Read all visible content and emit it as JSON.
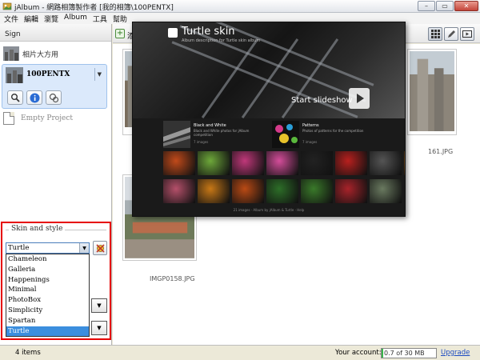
{
  "window": {
    "title": "jAlbum - 網路相簿製作者 [我的相簿\\100PENTX]",
    "controls": {
      "minimize": "–",
      "maximize": "▭",
      "close": "✕"
    }
  },
  "menu": [
    "文件",
    "編輯",
    "瀏覽",
    "Album",
    "工具",
    "幫助"
  ],
  "left_panel": {
    "header": "Sign",
    "projects": [
      {
        "label": "相片大方用",
        "active": false
      },
      {
        "label": "100PENTX",
        "active": true
      },
      {
        "label": "Empty Project",
        "active": false
      }
    ],
    "tool_icons": [
      "magnifier-icon",
      "info-icon",
      "explore-icon"
    ]
  },
  "skin": {
    "legend": "Skin and style",
    "selected": "Turtle",
    "options": [
      "Chameleon",
      "Galleria",
      "Happenings",
      "Minimal",
      "PhotoBox",
      "Simplicity",
      "Spartan",
      "Turtle"
    ],
    "selected_index": 7,
    "combo_arrow": "▼"
  },
  "toolbar": {
    "add_label": "添",
    "view_icons": [
      "thumbnail-grid-icon",
      "edit-icon",
      "preview-icon"
    ]
  },
  "thumbnails": [
    {
      "caption": "161.JPG"
    },
    {
      "caption": "IMGP0158.JPG"
    }
  ],
  "preview": {
    "title": "Turtle skin",
    "subtitle": "Album description for Turtle skin album",
    "slideshow_label": "Start slideshow",
    "folders": [
      {
        "title": "Black and White",
        "desc": "Black and White photos for jAlbum competition",
        "count": "7 images"
      },
      {
        "title": "Patterns",
        "desc": "Photos of patterns for the competition",
        "count": "7 images"
      }
    ],
    "footer": "21 images · Album by jAlbum & Turtle · Help",
    "tile_colors": [
      "#c14a1a",
      "#6ea83a",
      "#c0387a",
      "#d44d9a",
      "#222222",
      "#b8201e",
      "#555555",
      "#b0702a",
      "#b5506a",
      "#c87816",
      "#ba4a14",
      "#2d6e28",
      "#3a7a2a",
      "#a8232a",
      "#6a7a60"
    ]
  },
  "status": {
    "items": "4 items",
    "account_label": "Your account:",
    "quota_text": "0.7 of 30 MB used",
    "quota_fraction": 0.0233,
    "upgrade": "Upgrade"
  },
  "colors": {
    "highlight_box": "#e60000",
    "selection": "#3b8ede",
    "link": "#1a4ac2"
  }
}
